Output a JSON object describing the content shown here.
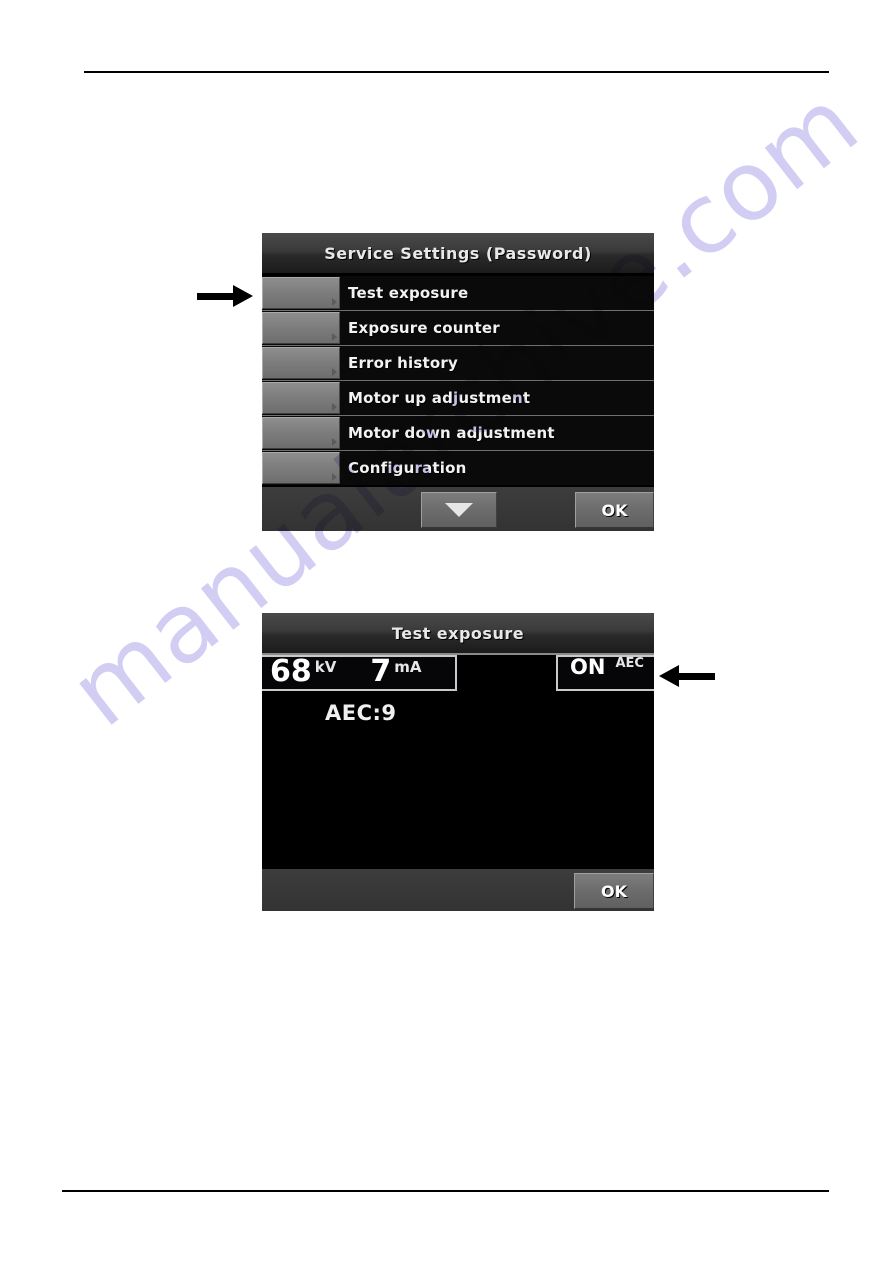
{
  "page": {
    "background_color": "#ffffff",
    "rule_color": "#000000",
    "watermark_text": "manualarchive.com",
    "watermark_color": "#d2cdf2"
  },
  "service_dialog": {
    "title": "Service Settings (Password)",
    "menu_items": [
      {
        "label": "Test exposure"
      },
      {
        "label": "Exposure counter"
      },
      {
        "label": "Error history"
      },
      {
        "label": "Motor up adjustment"
      },
      {
        "label": "Motor down adjustment"
      },
      {
        "label": "Configuration"
      }
    ],
    "footer": {
      "scroll_down_label": "",
      "ok_label": "OK"
    }
  },
  "test_exposure_dialog": {
    "title": "Test exposure",
    "readout": {
      "kv_value": "68",
      "kv_unit": "kV",
      "ma_value": "7",
      "ma_unit": "mA"
    },
    "aec_box": {
      "state": "ON",
      "label": "AEC"
    },
    "aec_reading": "AEC:9",
    "footer": {
      "ok_label": "OK"
    }
  },
  "annotations": {
    "arrow_menu_name": "arrow-pointing-to-test-exposure-row",
    "arrow_aec_name": "arrow-pointing-to-aec-on-indicator"
  }
}
